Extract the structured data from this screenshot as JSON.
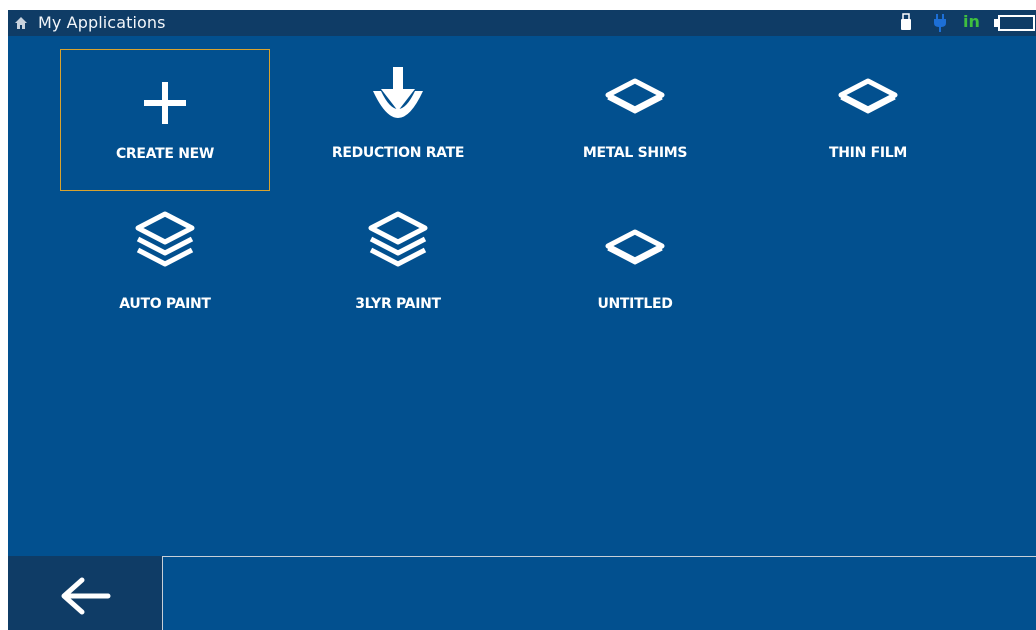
{
  "header": {
    "title": "My Applications",
    "icons": {
      "home": "home-icon",
      "usb": "usb-drive-icon",
      "power": "power-plug-icon",
      "battery": "battery-icon"
    },
    "status_text": "in",
    "status_text_color": "#3fbf3f"
  },
  "colors": {
    "background": "#02508f",
    "title_bar": "#0f3c66",
    "selection_border": "#d8a32e"
  },
  "applications": [
    {
      "label": "CREATE NEW",
      "icon": "plus-icon",
      "selected": true
    },
    {
      "label": "REDUCTION RATE",
      "icon": "reduction-arrow-icon",
      "selected": false
    },
    {
      "label": "METAL SHIMS",
      "icon": "single-layer-icon",
      "selected": false
    },
    {
      "label": "THIN FILM",
      "icon": "single-layer-icon",
      "selected": false
    },
    {
      "label": "AUTO PAINT",
      "icon": "multi-layer-icon",
      "selected": false
    },
    {
      "label": "3LYR PAINT",
      "icon": "multi-layer-icon",
      "selected": false
    },
    {
      "label": "UNTITLED",
      "icon": "single-layer-icon",
      "selected": false
    }
  ],
  "footer": {
    "back_icon": "back-arrow-icon"
  }
}
